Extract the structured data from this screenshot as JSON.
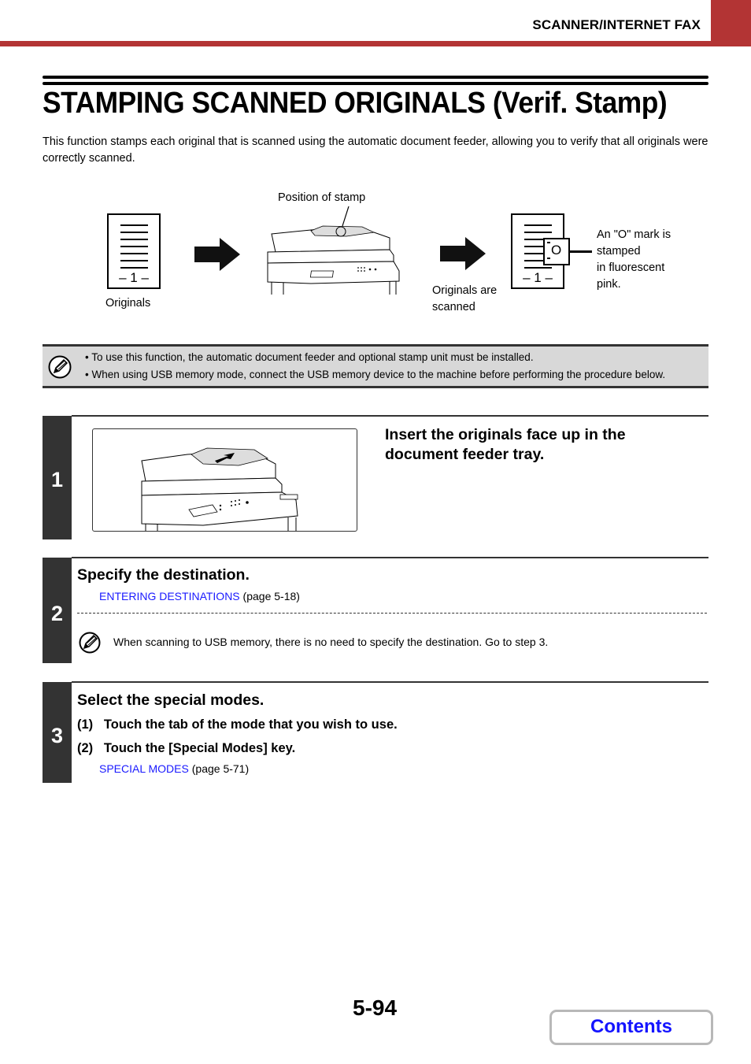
{
  "header": {
    "section": "SCANNER/INTERNET FAX",
    "accent_color": "#b33434"
  },
  "page_title": "STAMPING SCANNED ORIGINALS (Verif. Stamp)",
  "intro": "This function stamps each original that is scanned using the automatic document feeder, allowing you to verify that all originals were correctly scanned.",
  "diagram": {
    "position_label": "Position of stamp",
    "originals_label": "Originals",
    "scanned_label_1": "Originals are",
    "scanned_label_2": "scanned",
    "page_number": "– 1 –",
    "mark_label_1": "An \"O\" mark is",
    "mark_label_2": "stamped",
    "mark_label_3": "in fluorescent",
    "mark_label_4": "pink.",
    "stamp_glyph": "O"
  },
  "note": {
    "icon": "pencil-note-icon",
    "items": [
      "• To use this function, the automatic document feeder and optional stamp unit must be installed.",
      "• When using USB memory mode, connect the USB memory device to the machine before performing the procedure below."
    ]
  },
  "steps": [
    {
      "number": "1",
      "heading_1": "Insert the originals face up in the",
      "heading_2": "document feeder tray."
    },
    {
      "number": "2",
      "heading": "Specify the destination.",
      "link": "ENTERING DESTINATIONS",
      "link_page": " (page 5-18)",
      "note": "When scanning to USB memory, there is no need to specify the destination. Go to step 3."
    },
    {
      "number": "3",
      "heading": "Select the special modes.",
      "sub_1": "(1)   Touch the tab of the mode that you wish to use.",
      "sub_2": "(2)   Touch the [Special Modes] key.",
      "link": "SPECIAL MODES",
      "link_page": " (page 5-71)"
    }
  ],
  "footer": {
    "page_number": "5-94",
    "contents_label": "Contents",
    "link_color": "#1414ff"
  }
}
